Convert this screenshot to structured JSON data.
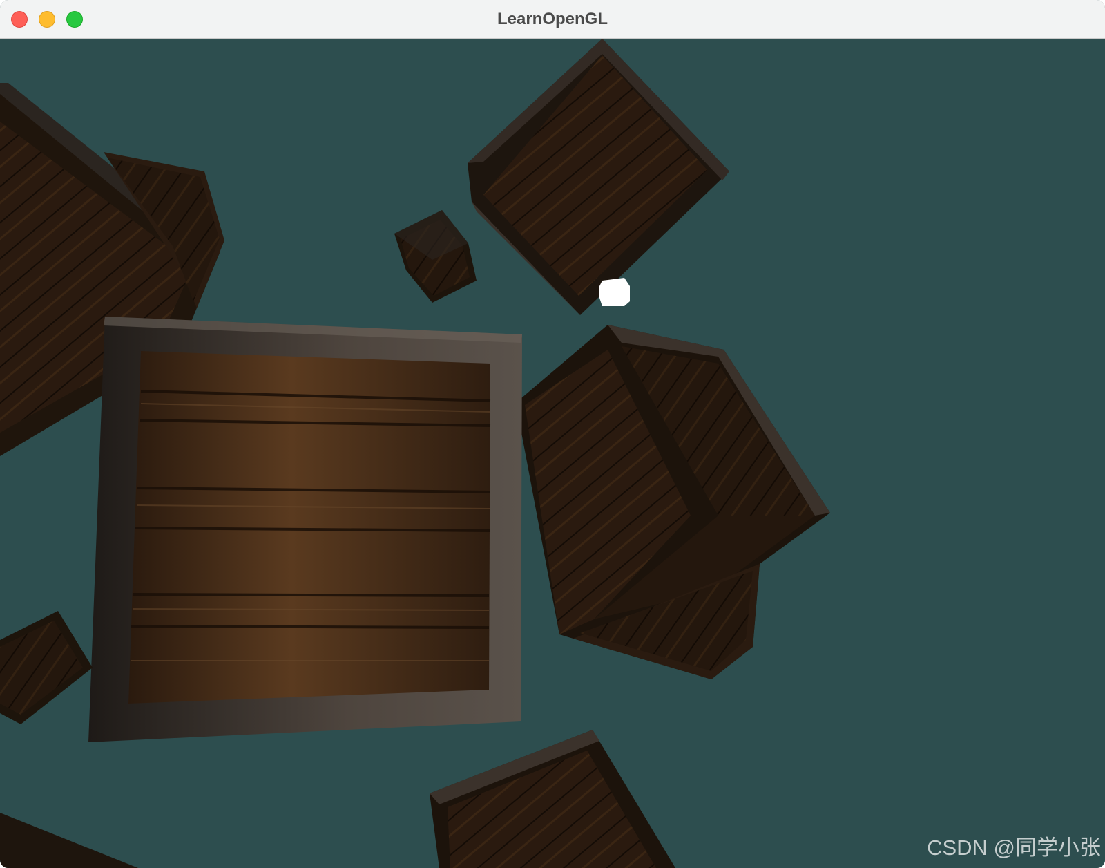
{
  "window": {
    "title": "LearnOpenGL",
    "controls": {
      "close": "close-icon",
      "minimize": "minimize-icon",
      "maximize": "maximize-icon"
    }
  },
  "scene": {
    "clear_color": "#2d4e4f",
    "light_cube_color": "#ffffff",
    "crate_colors": {
      "dark": "#1c130c",
      "wood": "#3b2616",
      "plank": "#4a2f1b",
      "frame": "#2b2520",
      "frame_light": "#5b514a"
    }
  },
  "watermark": "CSDN @同学小张"
}
